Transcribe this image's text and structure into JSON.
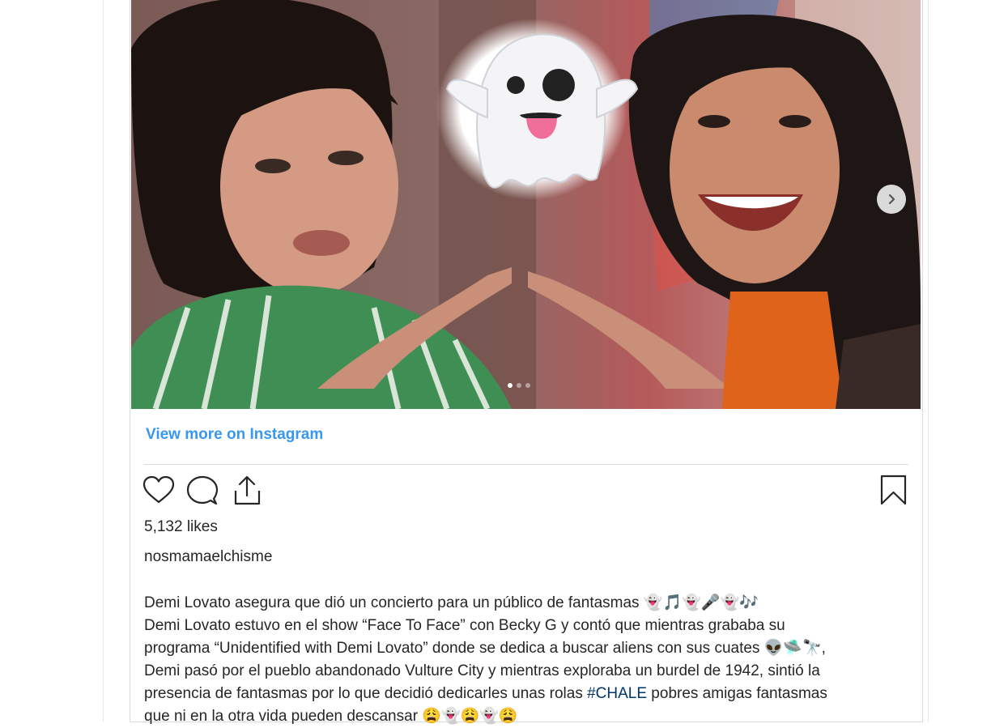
{
  "post": {
    "view_more_label": "View more on Instagram",
    "likes": "5,132 likes",
    "username": "nosmamaelchisme",
    "caption": {
      "line1": "Demi Lovato asegura que dió un concierto para un público de fantasmas 👻🎵👻🎤👻🎶",
      "line2": "Demi Lovato estuvo en el show “Face To Face” con Becky G y contó que mientras grababa su",
      "line3": "programa “Unidentified with Demi Lovato” donde se dedica a buscar aliens con sus cuates 👽🛸🔭,",
      "line4": "Demi pasó por el pueblo abandonado Vulture City y mientras exploraba un burdel de 1942, sintió la",
      "line5_before": "presencia de fantasmas por lo que decidió dedicarles unas rolas ",
      "hashtag": "#CHALE",
      "line5_after": " pobres amigas fantasmas",
      "line6": "que ni en la otra vida pueden descansar 😩👻😩👻😩"
    }
  },
  "carousel": {
    "slide_count": 3,
    "active_slide": 1
  },
  "icons": {
    "like": "heart-icon",
    "comment": "comment-icon",
    "share": "share-icon",
    "save": "bookmark-icon",
    "next": "chevron-right-icon",
    "media_overlay": "ghost-emoji"
  },
  "colors": {
    "link": "#3897f0",
    "hashtag": "#003569",
    "text": "#262626",
    "border": "#dbdbdb"
  }
}
